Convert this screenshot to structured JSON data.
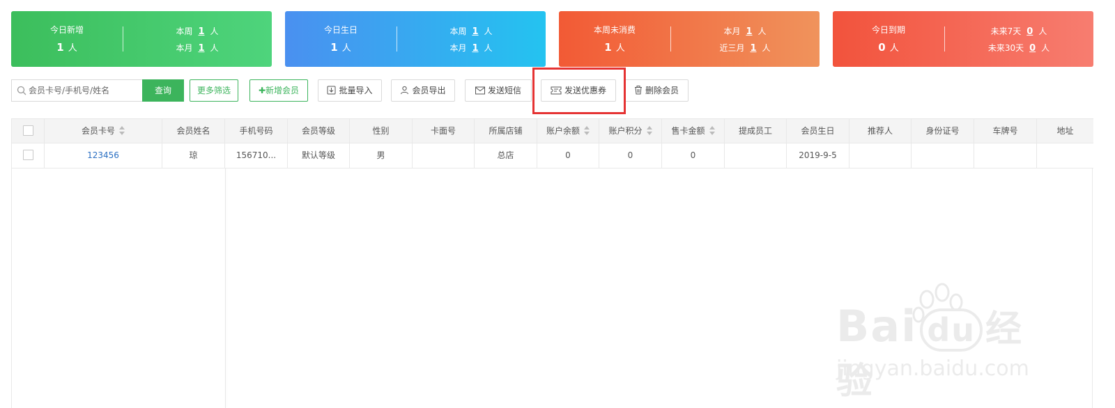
{
  "cards": [
    {
      "title": "今日新增",
      "value": "1",
      "unit": "人",
      "rows": [
        {
          "label": "本周",
          "value": "1",
          "unit": "人"
        },
        {
          "label": "本月",
          "value": "1",
          "unit": "人"
        }
      ]
    },
    {
      "title": "今日生日",
      "value": "1",
      "unit": "人",
      "rows": [
        {
          "label": "本周",
          "value": "1",
          "unit": "人"
        },
        {
          "label": "本月",
          "value": "1",
          "unit": "人"
        }
      ]
    },
    {
      "title": "本周未消费",
      "value": "1",
      "unit": "人",
      "rows": [
        {
          "label": "本月",
          "value": "1",
          "unit": "人"
        },
        {
          "label": "近三月",
          "value": "1",
          "unit": "人"
        }
      ]
    },
    {
      "title": "今日到期",
      "value": "0",
      "unit": "人",
      "rows": [
        {
          "label": "未来7天",
          "value": "0",
          "unit": "人"
        },
        {
          "label": "未来30天",
          "value": "0",
          "unit": "人"
        }
      ]
    }
  ],
  "toolbar": {
    "search_placeholder": "会员卡号/手机号/姓名",
    "query_label": "查询",
    "more_filter_label": "更多筛选",
    "add_member_label": "✚新增会员",
    "batch_import_label": "批量导入",
    "export_label": "会员导出",
    "send_sms_label": "发送短信",
    "send_coupon_label": "发送优惠券",
    "delete_label": "删除会员"
  },
  "table": {
    "columns": [
      "会员卡号",
      "会员姓名",
      "手机号码",
      "会员等级",
      "性别",
      "卡面号",
      "所属店铺",
      "账户余额",
      "账户积分",
      "售卡金额",
      "提成员工",
      "会员生日",
      "推荐人",
      "身份证号",
      "车牌号",
      "地址"
    ],
    "rows": [
      {
        "card_no": "123456",
        "name": "琼",
        "phone": "156710...",
        "level": "默认等级",
        "gender": "男",
        "face_no": "",
        "store": "总店",
        "balance": "0",
        "points": "0",
        "sale_amount": "0",
        "staff": "",
        "birthday": "2019-9-5",
        "referrer": "",
        "id_no": "",
        "plate": "",
        "address": ""
      }
    ]
  },
  "watermark": {
    "brand": "Bai",
    "brand_du": "du",
    "brand_cn": "经验",
    "url": "jingyan.baidu.com"
  },
  "colors": {
    "green": "#3cb45c",
    "highlight_red": "#e53333",
    "link_blue": "#2a6fc2"
  }
}
